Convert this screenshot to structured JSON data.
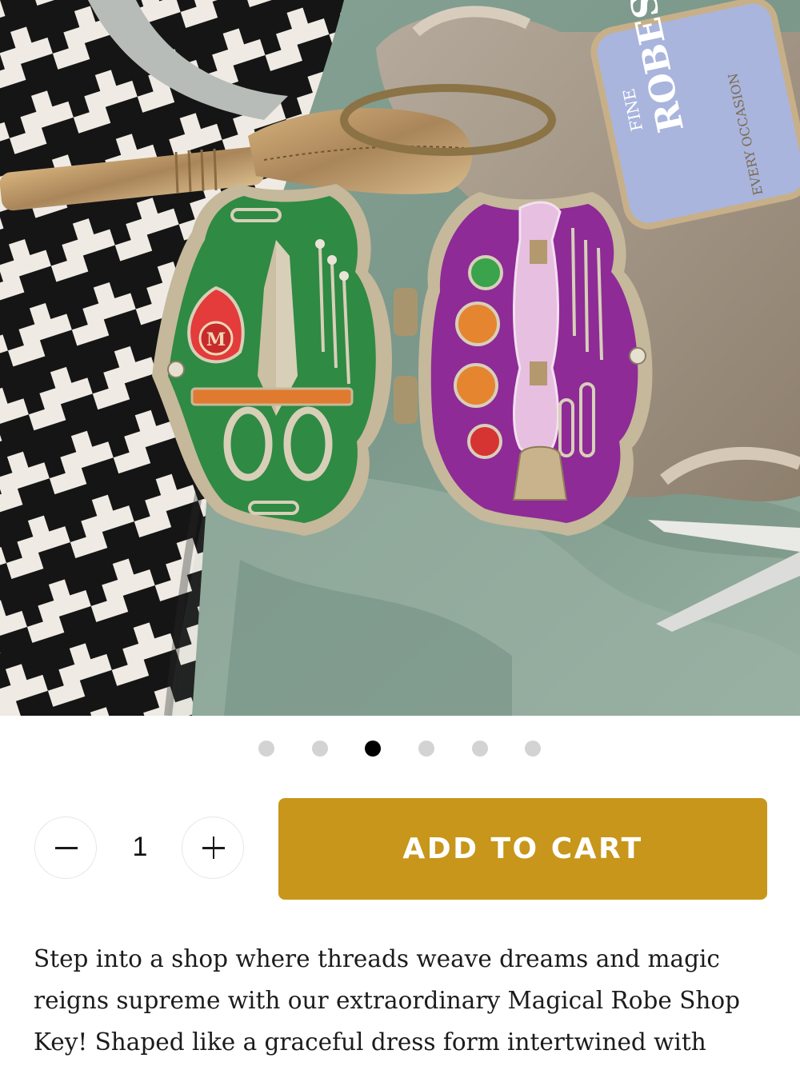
{
  "product_image": {
    "alt_icon": "enamel-locket-keychain-photo",
    "tag_text": {
      "top": "FINE",
      "main": "ROBES",
      "side": "EVERY OCCASION"
    },
    "locket_letter": "M"
  },
  "carousel": {
    "count": 6,
    "active_index": 2
  },
  "quantity": {
    "value": "1",
    "decrease_icon": "minus-icon",
    "increase_icon": "plus-icon"
  },
  "cart": {
    "add_label": "ADD TO CART",
    "button_color": "#c7961a"
  },
  "description": {
    "text": "Step into a shop where threads weave dreams and magic reigns supreme with our extraordinary Magical Robe Shop Key! Shaped like a graceful dress form intertwined with spools of thread, this"
  }
}
